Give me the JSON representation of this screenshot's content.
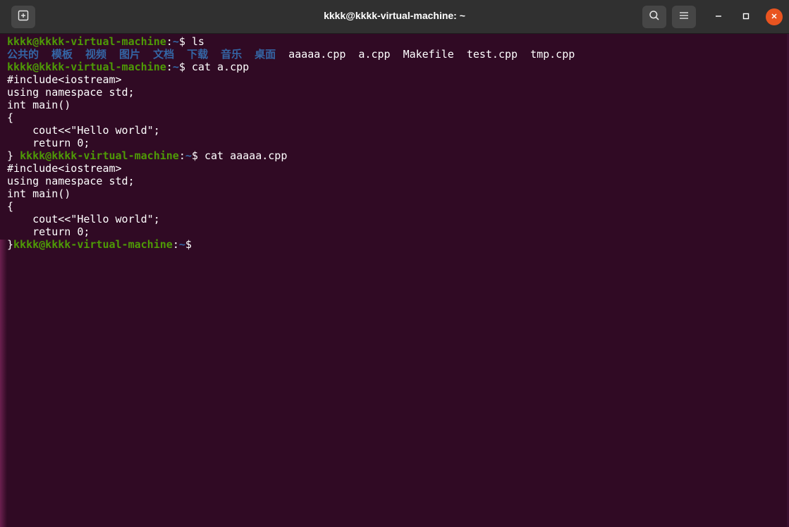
{
  "window": {
    "title": "kkkk@kkkk-virtual-machine: ~"
  },
  "icons": {
    "new_tab": "new-tab-icon",
    "search": "search-icon",
    "menu": "hamburger-menu-icon",
    "minimize": "minimize-icon",
    "maximize": "maximize-icon",
    "close": "close-icon"
  },
  "colors": {
    "background": "#300a24",
    "user_host": "#4e9a06",
    "path_dir": "#3465a4",
    "close_button": "#e95420"
  },
  "terminal": {
    "prompt_user": "kkkk@kkkk-virtual-machine",
    "prompt_colon": ":",
    "prompt_path": "~",
    "prompt_dollar": "$",
    "cmd1": " ls",
    "ls_dirs": [
      "公共的",
      "模板",
      "视频",
      "图片",
      "文档",
      "下载",
      "音乐",
      "桌面"
    ],
    "ls_files": [
      "aaaaa.cpp",
      "a.cpp",
      "Makefile",
      "test.cpp",
      "tmp.cpp"
    ],
    "cmd2": " cat a.cpp",
    "file1": [
      "#include<iostream>",
      "using namespace std;",
      "int main()",
      "{",
      "    cout<<\"Hello world\";",
      "    return 0;"
    ],
    "file1_end": "} ",
    "cmd3": " cat aaaaa.cpp",
    "file2": [
      "#include<iostream>",
      "using namespace std;",
      "int main()",
      "{",
      "    cout<<\"Hello world\";",
      "    return 0;"
    ],
    "file2_end": "}"
  }
}
